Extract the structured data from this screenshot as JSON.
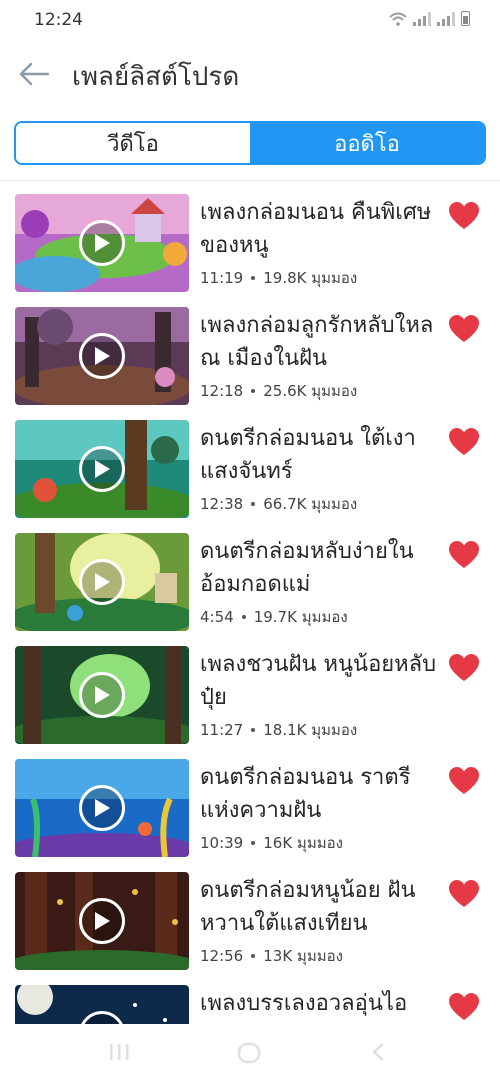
{
  "status": {
    "time": "12:24"
  },
  "header": {
    "title": "เพลย์ลิสต์โปรด",
    "back_icon": "arrow-left-icon"
  },
  "tabs": [
    {
      "label": "วีดีโอ",
      "active": false
    },
    {
      "label": "ออดิโอ",
      "active": true
    }
  ],
  "colors": {
    "accent": "#2196f3",
    "heart": "#e53945"
  },
  "items": [
    {
      "title": "เพลงกล่อมนอน คืนพิเศษของหนู",
      "duration": "11:19",
      "views": "19.8K มุมมอง"
    },
    {
      "title": "เพลงกล่อมลูกรักหลับใหล ณ เมืองในฝัน",
      "duration": "12:18",
      "views": "25.6K มุมมอง"
    },
    {
      "title": "ดนตรีกล่อมนอน ใต้เงาแสงจันทร์",
      "duration": "12:38",
      "views": "66.7K มุมมอง"
    },
    {
      "title": "ดนตรีกล่อมหลับง่ายในอ้อมกอดแม่",
      "duration": "4:54",
      "views": "19.7K มุมมอง"
    },
    {
      "title": "เพลงชวนฝัน หนูน้อยหลับปุ๋ย",
      "duration": "11:27",
      "views": "18.1K มุมมอง"
    },
    {
      "title": "ดนตรีกล่อมนอน ราตรีแห่งความฝัน",
      "duration": "10:39",
      "views": "16K มุมมอง"
    },
    {
      "title": "ดนตรีกล่อมหนูน้อย ฝันหวานใต้แสงเทียน",
      "duration": "12:56",
      "views": "13K มุมมอง"
    },
    {
      "title": "เพลงบรรเลงอวลอุ่นไอ",
      "duration": "",
      "views": ""
    }
  ]
}
